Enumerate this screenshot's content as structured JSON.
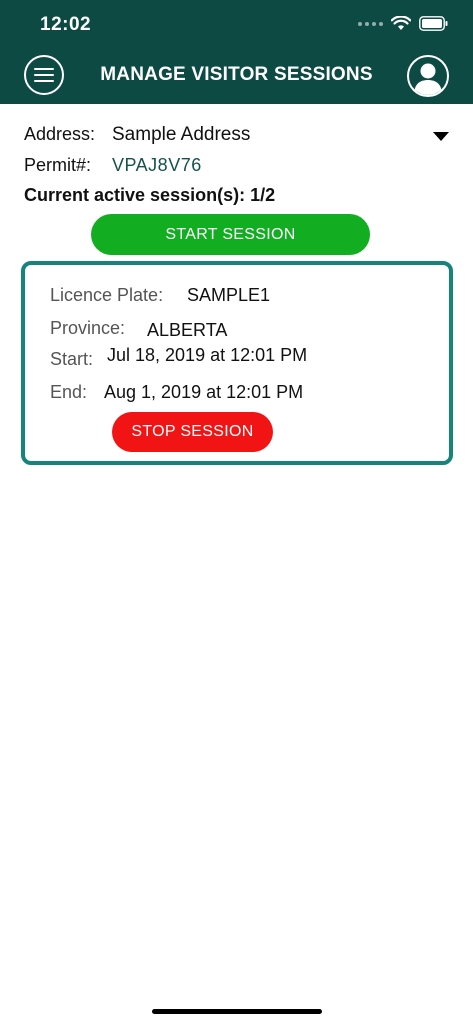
{
  "status_bar": {
    "time": "12:02"
  },
  "header": {
    "title": "MANAGE VISITOR SESSIONS",
    "background_color": "#0e4a44"
  },
  "info": {
    "address_label": "Address:",
    "address_value": "Sample Address",
    "permit_label": "Permit#:",
    "permit_value": "VPAJ8V76",
    "active_sessions": "Current active session(s): 1/2"
  },
  "actions": {
    "start_label": "START SESSION",
    "start_color": "#13ad22"
  },
  "session": {
    "plate_label": "Licence Plate:",
    "plate_value": "SAMPLE1",
    "province_label": "Province:",
    "province_value": "ALBERTA",
    "start_label": "Start:",
    "start_value": "Jul 18, 2019 at 12:01 PM",
    "end_label": "End:",
    "end_value": "Aug 1, 2019 at 12:01 PM",
    "stop_label": "STOP SESSION",
    "stop_color": "#f21414",
    "border_color": "#15847d"
  },
  "icons": {
    "menu": "hamburger-menu-icon",
    "profile": "user-avatar-icon",
    "wifi": "wifi-icon",
    "battery": "battery-icon",
    "dropdown": "dropdown-caret-icon"
  }
}
